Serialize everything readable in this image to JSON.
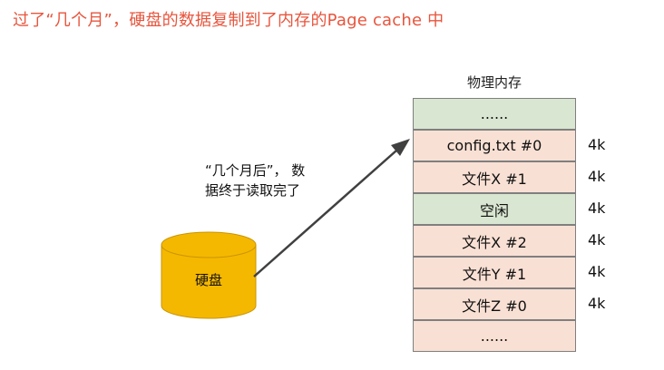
{
  "headline": "过了“几个月”，硬盘的数据复制到了内存的Page cache 中",
  "memory": {
    "title": "物理内存",
    "rows": [
      {
        "label": "......",
        "size": "",
        "color": "#d9e6d1"
      },
      {
        "label": "config.txt #0",
        "size": "4k",
        "color": "#f9e0d4"
      },
      {
        "label": "文件X  #1",
        "size": "4k",
        "color": "#f9e0d4"
      },
      {
        "label": "空闲",
        "size": "4k",
        "color": "#d9e6d1"
      },
      {
        "label": "文件X  #2",
        "size": "4k",
        "color": "#f9e0d4"
      },
      {
        "label": "文件Y #1",
        "size": "4k",
        "color": "#f9e0d4"
      },
      {
        "label": "文件Z #0",
        "size": "4k",
        "color": "#f9e0d4"
      },
      {
        "label": "......",
        "size": "",
        "color": "#f9e0d4"
      }
    ]
  },
  "caption": {
    "line1": "“几个月后”， 数",
    "line2": "据终于读取完了"
  },
  "disk": {
    "label": "硬盘",
    "fill": "#f5b800",
    "stroke": "#c99400"
  },
  "arrow": {
    "color": "#404040"
  }
}
